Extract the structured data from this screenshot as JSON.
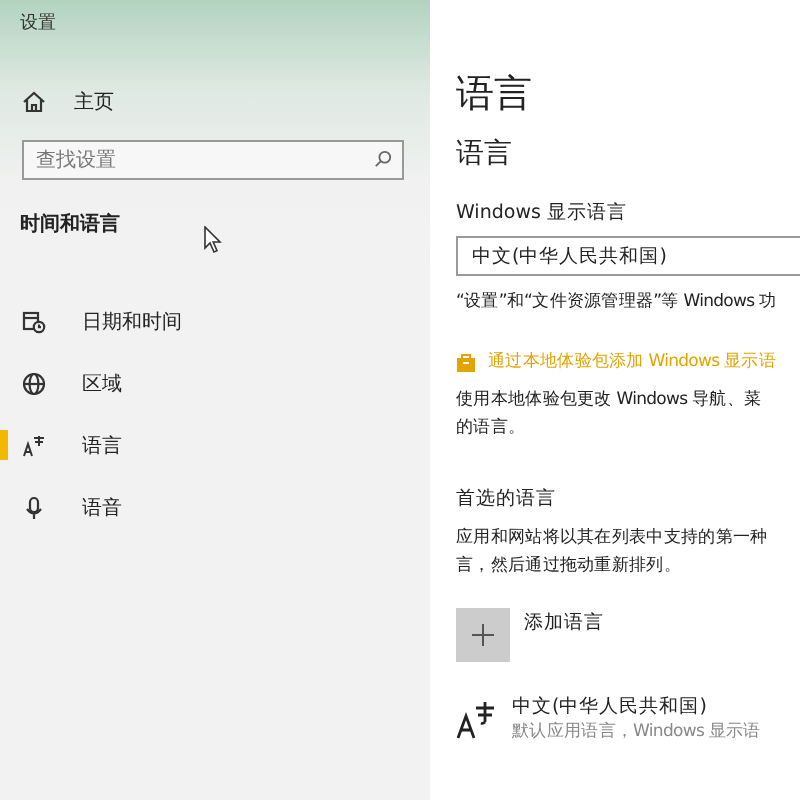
{
  "window": {
    "title": "设置"
  },
  "sidebar": {
    "home": {
      "label": "主页"
    },
    "search": {
      "placeholder": "查找设置"
    },
    "section_title": "时间和语言",
    "items": [
      {
        "kind": "calendar",
        "label": "日期和时间",
        "selected": false
      },
      {
        "kind": "globe",
        "label": "区域",
        "selected": false
      },
      {
        "kind": "language",
        "label": "语言",
        "selected": true
      },
      {
        "kind": "microphone",
        "label": "语音",
        "selected": false
      }
    ]
  },
  "page": {
    "title": "语言",
    "subtitle": "语言",
    "display_language": {
      "label": "Windows 显示语言",
      "value": "中文(中华人民共和国)",
      "note": "“设置”和“文件资源管理器”等 Windows 功"
    },
    "store_link": "通过本地体验包添加 Windows 显示语",
    "store_note": [
      "使用本地体验包更改 Windows 导航、菜",
      "的语言。"
    ],
    "preferred": {
      "title": "首选的语言",
      "note": [
        "应用和网站将以其在列表中支持的第一种",
        "言，然后通过拖动重新排列。"
      ],
      "add_label": "添加语言",
      "languages": [
        {
          "name": "中文(中华人民共和国)",
          "detail": "默认应用语言，Windows 显示语"
        }
      ]
    }
  }
}
